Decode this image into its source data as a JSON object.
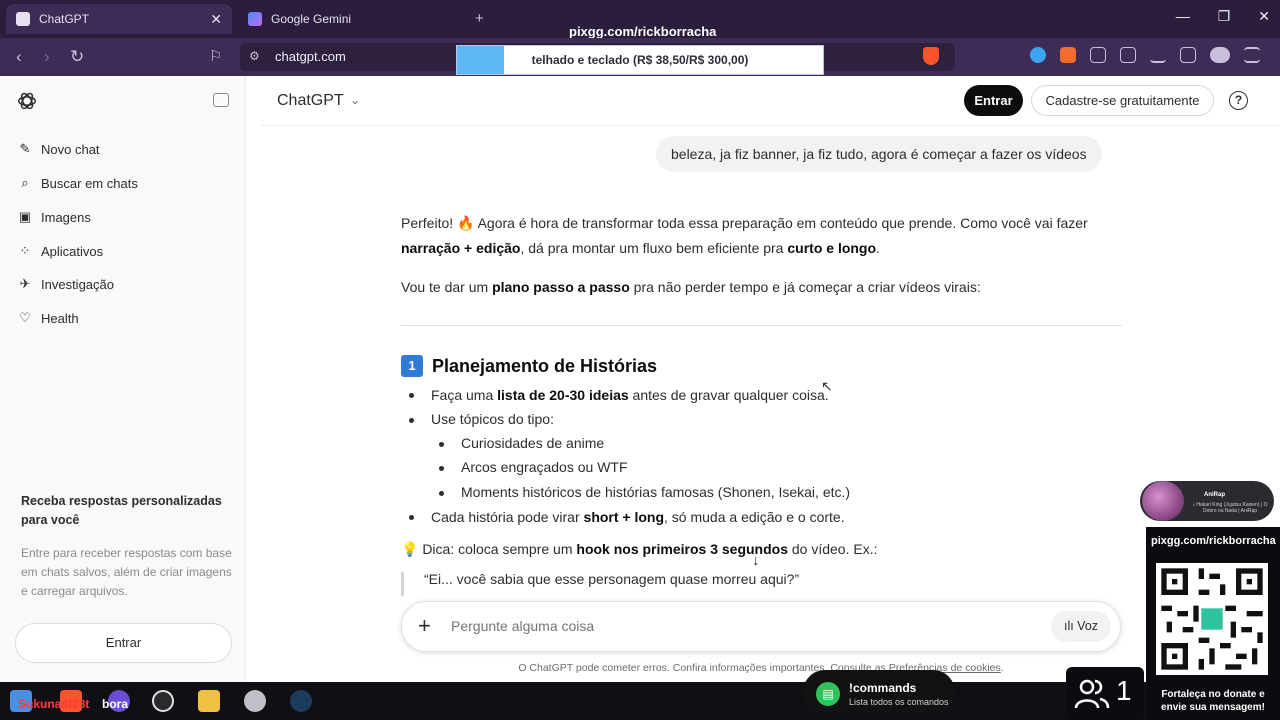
{
  "browser": {
    "tabs": [
      {
        "title": "ChatGPT",
        "active": true
      },
      {
        "title": "Google Gemini",
        "active": false
      }
    ],
    "url": "chatgpt.com",
    "new_tab": "+",
    "window_controls": {
      "minimize": "—",
      "maximize": "❐",
      "close": "✕"
    }
  },
  "stream_overlay": {
    "title_handle": "pixgg.com/rickborracha",
    "goal_text": "telhado e teclado (R$ 38,50/R$ 300,00)",
    "goal_progress": 0.128,
    "song": {
      "title": "AniRap",
      "subtitle": "♪ Hakari King (Jujutsu Kaisen) | O Dobro ou Nada | AniRap"
    },
    "qr_handle": "pixgg.com/rickborracha",
    "qr_caption": "Fortaleça no donate e envie sua mensagem!",
    "commands": {
      "title": "!commands",
      "subtitle": "Lista todos os comandos"
    },
    "viewer_count": "1"
  },
  "sidebar": {
    "items": [
      {
        "label": "Novo chat",
        "icon": "edit-icon"
      },
      {
        "label": "Buscar em chats",
        "icon": "search-icon"
      },
      {
        "label": "Imagens",
        "icon": "image-icon"
      },
      {
        "label": "Aplicativos",
        "icon": "apps-icon"
      },
      {
        "label": "Investigação",
        "icon": "telescope-icon"
      },
      {
        "label": "Health",
        "icon": "heart-icon"
      }
    ],
    "promo_title": "Receba respostas personalizadas para você",
    "promo_text": "Entre para receber respostas com base em chats salvos, além de criar imagens e carregar arquivos.",
    "login_label": "Entrar"
  },
  "header": {
    "model": "ChatGPT",
    "login_label": "Entrar",
    "signup_label": "Cadastre-se gratuitamente",
    "help": "?"
  },
  "chat": {
    "user_message": "beleza, ja fiz banner, ja fiz tudo, agora é começar a fazer os vídeos",
    "p1": {
      "a": "Perfeito! 🔥 Agora é hora de transformar toda essa preparação em conteúdo que prende. Como você vai fazer ",
      "b": "narração + edição",
      "c": ", dá pra montar um fluxo bem eficiente pra ",
      "d": "curto e longo",
      "e": "."
    },
    "p2": {
      "a": "Vou te dar um ",
      "b": "plano passo a passo",
      "c": " pra não perder tempo e já começar a criar vídeos virais:"
    },
    "section_number": "1",
    "section_title": "Planejamento de Histórias",
    "bullets": {
      "b1": {
        "a": "Faça uma ",
        "b": "lista de 20-30 ideias",
        "c": " antes de gravar qualquer coisa."
      },
      "b2": "Use tópicos do tipo:",
      "sub": [
        "Curiosidades de anime",
        "Arcos engraçados ou WTF",
        "Moments históricos de histórias famosas (Shonen, Isekai, etc.)"
      ],
      "b3": {
        "a": "Cada história pode virar ",
        "b": "short + long",
        "c": ", só muda a edição e o corte."
      }
    },
    "tip": {
      "a": "💡 Dica: coloca sempre um ",
      "b": "hook nos primeiros 3 segundos",
      "c": " do vídeo. Ex.:"
    },
    "quote": "“Ei... você sabia que esse personagem quase morreu aqui?”"
  },
  "composer": {
    "placeholder": "Pergunte alguma coisa",
    "voice_label": "Voz",
    "disclaimer_a": "O ChatGPT pode cometer erros. Confira informações importantes. Consulte as ",
    "disclaimer_link": "Preferências de cookies",
    "disclaimer_b": "."
  },
  "taskbar": {
    "user_label": "Sukuna4f28t",
    "bora_label": "bora"
  },
  "colors": {
    "browser_frame": "#2b1d3d",
    "browser_toolbar": "#3d2c55",
    "primary_button": "#0d0d0d",
    "goal_fill": "#5eb6f5"
  }
}
